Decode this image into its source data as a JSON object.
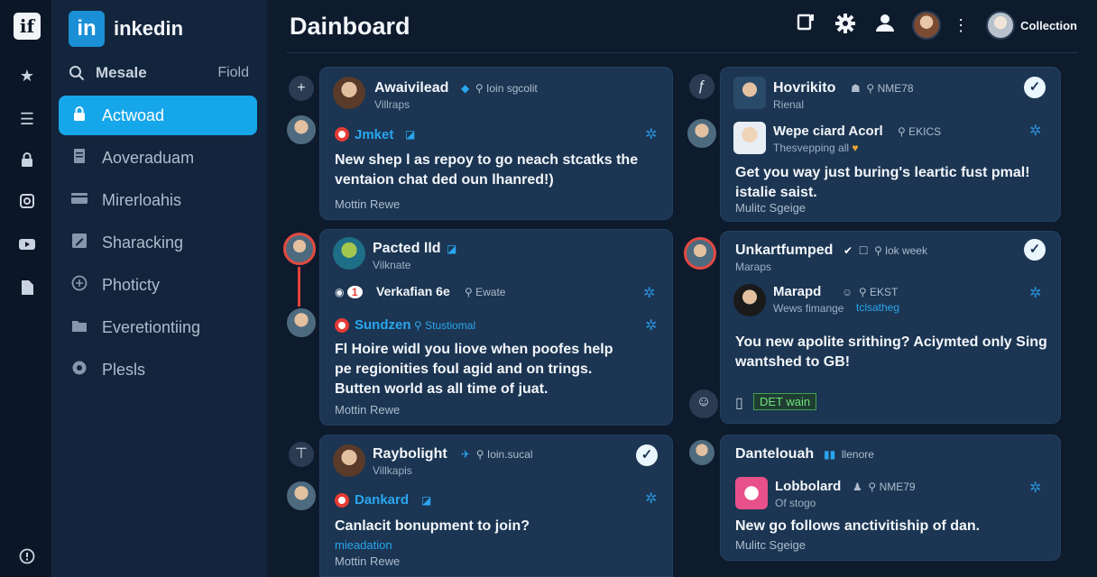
{
  "rail": {
    "logo": "if",
    "icons": [
      "star-icon",
      "list-icon",
      "lock-icon",
      "camera-icon",
      "video-icon",
      "document-icon",
      "info-icon"
    ]
  },
  "sidebar": {
    "brand": {
      "badge": "in",
      "name": "inkedin"
    },
    "search": {
      "label": "Mesale",
      "field": "Fiold"
    },
    "items": [
      {
        "label": "Actwoad",
        "icon": "lock-icon",
        "active": true
      },
      {
        "label": "Aoveraduam",
        "icon": "document-icon"
      },
      {
        "label": "Mirerloahis",
        "icon": "card-icon"
      },
      {
        "label": "Sharacking",
        "icon": "edit-icon"
      },
      {
        "label": "Photicty",
        "icon": "dollar-icon"
      },
      {
        "label": "Everetiontiing",
        "icon": "folder-icon"
      },
      {
        "label": "Plesls",
        "icon": "settings-icon"
      }
    ]
  },
  "header": {
    "title": "Dainboard",
    "collection": "Collection"
  },
  "cards": {
    "c1": {
      "name": "Awaivilead",
      "meta": "Ioin sgcolit",
      "sub": "Villraps",
      "tag": "Jmket",
      "body": "New shep l as repoy to go neach stcatks the ventaion chat ded oun lhanred!)",
      "foot": "Mottin Rewe"
    },
    "c2": {
      "name": "Pacted lld",
      "sub": "Vilknate",
      "name2": "Verkafian 6e",
      "meta2": "Ewate",
      "tag": "Sundzen",
      "tag_extra": "Stustiomal",
      "body": "Fl Hoire widl you liove when poofes help pe regionities foul agid and on trings. Butten world as all time of juat.",
      "foot": "Mottin Rewe"
    },
    "c3": {
      "name": "Raybolight",
      "meta": "Ioin.sucal",
      "sub": "Villkapis",
      "tag": "Dankard",
      "body": "Canlacit bonupment to join?",
      "link": "mieadation",
      "foot": "Mottin Rewe"
    },
    "c4": {
      "name": "Hovrikito",
      "meta": "NME78",
      "sub": "Rienal",
      "name2": "Wepe ciard Acorl",
      "meta2": "EKICS",
      "sub2": "Thesvepping all",
      "body": "Get you way just buring's leartic fust pmal! istalie saist.",
      "foot": "Mulitc Sgeige"
    },
    "c5": {
      "name": "Unkartfumped",
      "meta": "lok week",
      "sub": "Maraps",
      "name2": "Marapd",
      "meta2": "EKST",
      "sub2": "Wews fimange",
      "link2": "tclsatheg",
      "body": "You new apolite srithing? Aciymted only Sing wantshed to GB!",
      "badge": "DET wain"
    },
    "c6": {
      "name": "Dantelouah",
      "meta": "llenore",
      "name2": "Lobbolard",
      "meta2": "NME79",
      "sub2": "Of stogo",
      "body": "New go follows anctivitiship of dan.",
      "foot": "Mulitc Sgeige"
    }
  }
}
